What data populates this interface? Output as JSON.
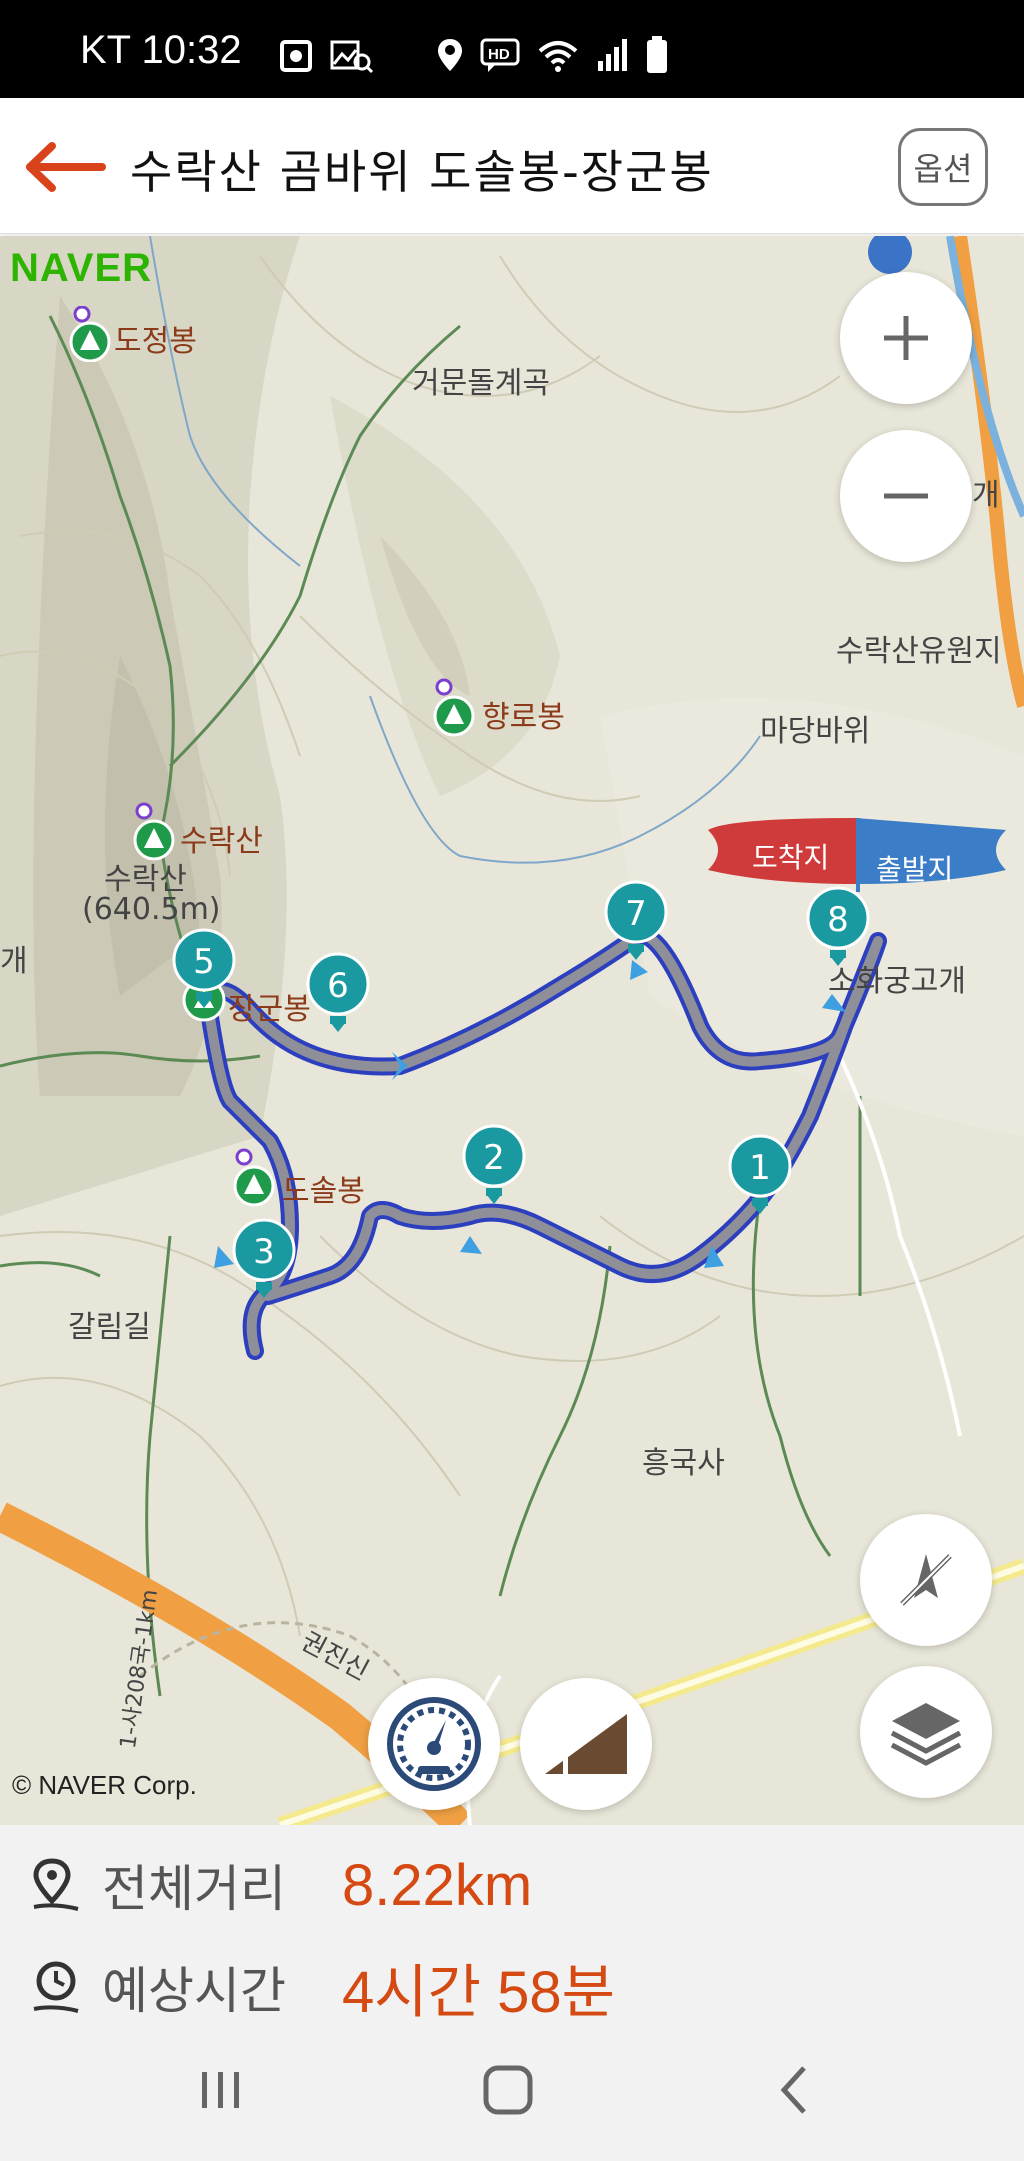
{
  "status_bar": {
    "carrier_time": "KT 10:32"
  },
  "header": {
    "title": "수락산 곰바위 도솔봉-장군봉",
    "option_label": "옵션"
  },
  "map": {
    "brand": "NAVER",
    "copyright": "© NAVER Corp.",
    "labels": {
      "dojeongbong": "도정봉",
      "geomundol": "거문돌계곡",
      "suraksan_resort": "수락산유원지",
      "madangbawi": "마당바위",
      "hyangrobong": "향로봉",
      "suraksan_peak": "수락산",
      "suraksan_name": "수락산",
      "suraksan_height": "(640.5m)",
      "gae_left": "개",
      "gae_right": "개",
      "janggunbong": "장군봉",
      "sohwagung": "소화궁고개",
      "dosolbong": "도솔봉",
      "garimgil": "갈림길",
      "heungguksa": "흥국사",
      "road_label": "1-사208국-1km",
      "road_label2": "권진신"
    },
    "flags": {
      "arrival": "도착지",
      "departure": "출발지"
    },
    "waypoints": [
      "1",
      "2",
      "3",
      "5",
      "6",
      "7",
      "8"
    ],
    "route_color": "#2b3fbf",
    "marker_color": "#1a9aa0"
  },
  "info": {
    "distance_label": "전체거리",
    "distance_value": "8.22km",
    "time_label": "예상시간",
    "time_value": "4시간 58분"
  }
}
